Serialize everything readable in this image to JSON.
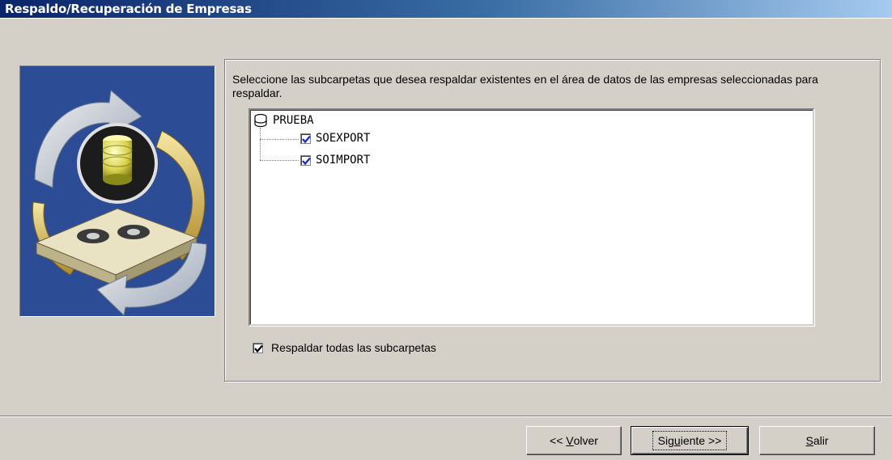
{
  "window": {
    "title": "Respaldo/Recuperación de Empresas"
  },
  "instructions": "Seleccione las subcarpetas que desea respaldar existentes en el área de datos de las empresas seleccionadas para respaldar.",
  "tree": {
    "root": {
      "label": "PRUEBA",
      "icon": "database-icon"
    },
    "children": [
      {
        "label": "SOEXPORT",
        "checked": true
      },
      {
        "label": "SOIMPORT",
        "checked": true
      }
    ]
  },
  "backup_all": {
    "label": "Respaldar todas las subcarpetas",
    "checked": true
  },
  "buttons": {
    "back": {
      "prefix": "<< ",
      "mnemonic": "V",
      "rest": "olver"
    },
    "next": {
      "pre": "Sig",
      "mnemonic": "u",
      "post": "iente >>"
    },
    "exit": {
      "mnemonic": "S",
      "rest": "alir"
    }
  },
  "colors": {
    "title_gradient_start": "#0a246a",
    "title_gradient_end": "#a6caf0",
    "dialog_bg": "#d4d0c8",
    "picture_bg": "#2c4d96",
    "check_color": "#1a2fd0"
  }
}
